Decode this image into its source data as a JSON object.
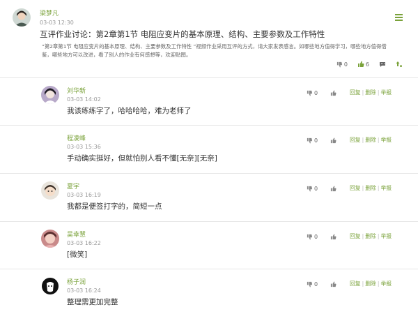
{
  "post": {
    "author": "梁梦凡",
    "time": "03-03 12:30",
    "title": "互评作业讨论：第2章第1节 电阻应变片的基本原理、结构、主要参数及工作特性",
    "description": "“第2章第1节 电阻应变片的基本原理、结构、主要参数及工作特性 ”视频作业采用互评的方式，请大家发表感言。如哪些地方值得学习，哪些地方值得借鉴，哪些地方可以改进，看了别人的作业有何感想等，欢迎贴图。",
    "dislike_count": "0",
    "like_count": "6"
  },
  "comments": [
    {
      "author": "刘华新",
      "time": "03-03 14:02",
      "text": "我该练练字了，哈哈哈哈，难为老师了",
      "dislike_count": "0",
      "reply_label": "回复",
      "delete_label": "删除",
      "report_label": "举报"
    },
    {
      "author": "程凌峰",
      "time": "03-03 15:36",
      "text": "手动确实挺好，但就怕别人看不懂[无奈][无奈]",
      "dislike_count": "0",
      "reply_label": "回复",
      "delete_label": "删除",
      "report_label": "举报"
    },
    {
      "author": "夏宇",
      "time": "03-03 16:19",
      "text": "我都是便签打字的，简短一点",
      "dislike_count": "0",
      "reply_label": "回复",
      "delete_label": "删除",
      "report_label": "举报"
    },
    {
      "author": "吴幸慧",
      "time": "03-03 16:22",
      "text": "[微笑]",
      "dislike_count": "0",
      "reply_label": "回复",
      "delete_label": "删除",
      "report_label": "举报"
    },
    {
      "author": "杨子润",
      "time": "03-03 16:24",
      "text": "整理需更加完整",
      "dislike_count": "0",
      "reply_label": "回复",
      "delete_label": "删除",
      "report_label": "举报"
    }
  ],
  "colors": {
    "accent": "#7aa23a",
    "divider": "#e6e6e6",
    "icon": "#888888"
  },
  "icons": {
    "menu": "hamburger-menu-icon",
    "dislike": "thumbs-down-icon",
    "like": "thumbs-up-icon",
    "comment": "comment-icon",
    "top": "arrow-up-icon"
  }
}
